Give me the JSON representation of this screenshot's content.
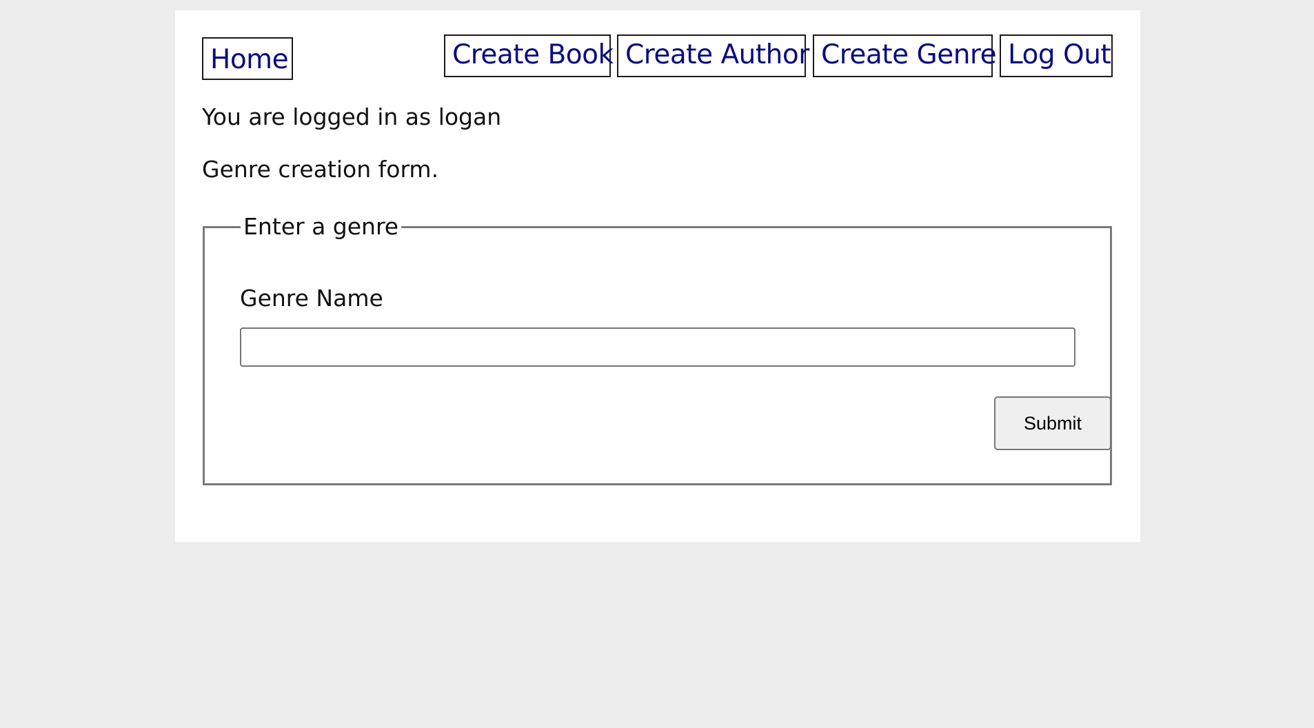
{
  "nav": {
    "home": "Home",
    "create_book": "Create Book",
    "create_author": "Create Author",
    "create_genre": "Create Genre",
    "log_out": "Log Out"
  },
  "status_text": "You are logged in as logan",
  "intro_text": "Genre creation form.",
  "form": {
    "legend": "Enter a genre",
    "genre_name_label": "Genre Name",
    "genre_name_value": "",
    "submit_label": "Submit"
  },
  "colors": {
    "page_background": "#ededed",
    "card_background": "#ffffff",
    "link_color": "#0b0b80"
  }
}
